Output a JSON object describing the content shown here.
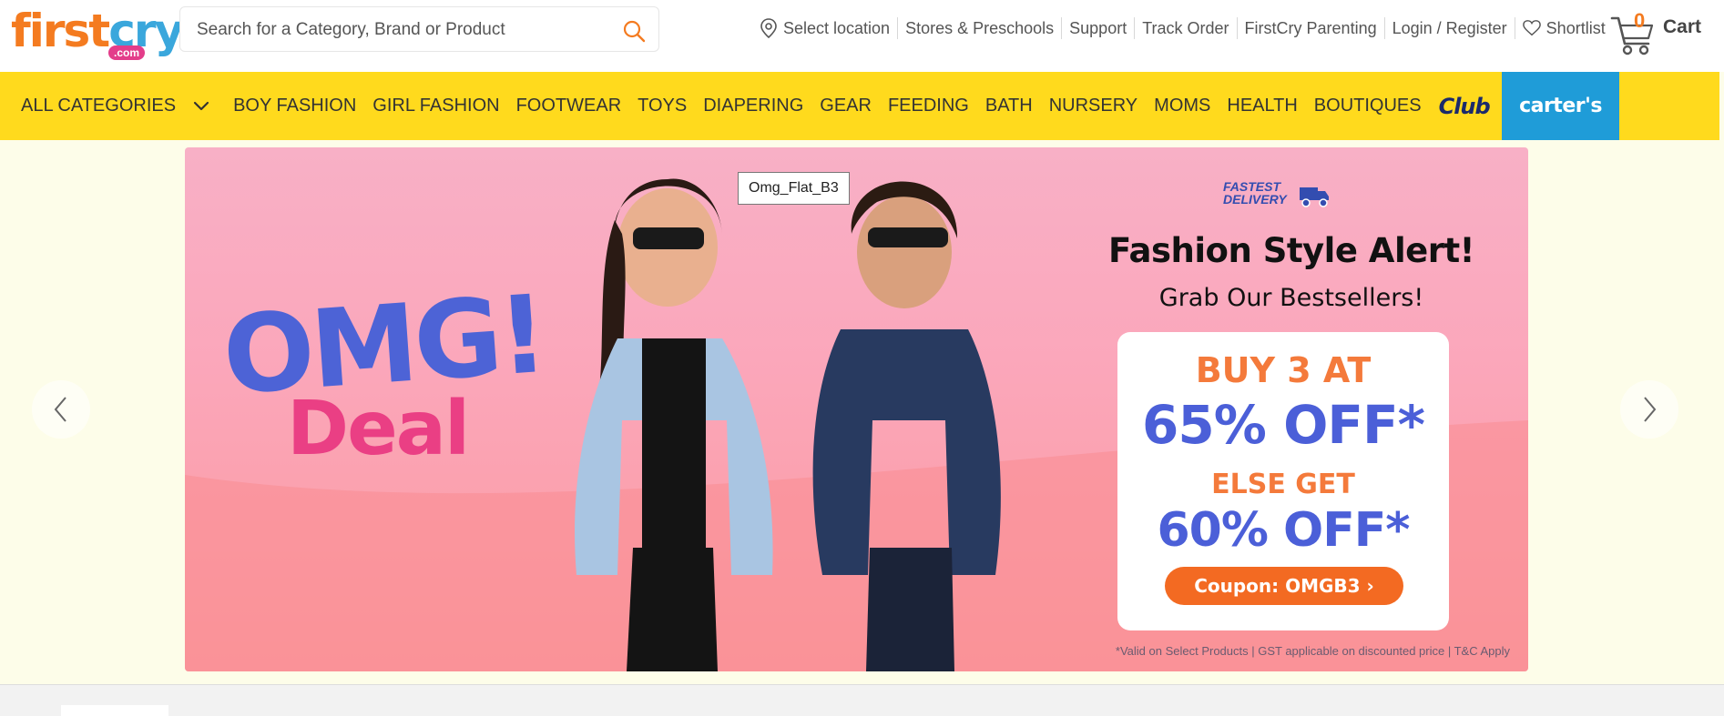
{
  "header": {
    "logo_main_1": "first",
    "logo_main_2": "cry",
    "logo_sub": ".com",
    "search_placeholder": "Search for a Category, Brand or Product",
    "links": {
      "location": "Select location",
      "stores": "Stores & Preschools",
      "support": "Support",
      "track": "Track Order",
      "parenting": "FirstCry Parenting",
      "login": "Login / Register",
      "shortlist": "Shortlist"
    },
    "cart_count": "0",
    "cart_label": "Cart"
  },
  "nav": {
    "all_categories": "ALL CATEGORIES",
    "items": [
      "BOY FASHION",
      "GIRL FASHION",
      "FOOTWEAR",
      "TOYS",
      "DIAPERING",
      "GEAR",
      "FEEDING",
      "BATH",
      "NURSERY",
      "MOMS",
      "HEALTH",
      "BOUTIQUES"
    ],
    "club": "Club",
    "carters": "carter's"
  },
  "banner": {
    "tooltip": "Omg_Flat_B3",
    "omg": "OMG!",
    "deal": "Deal",
    "fastest_1": "FASTEST",
    "fastest_2": "DELIVERY",
    "headline": "Fashion Style Alert!",
    "subline": "Grab Our Bestsellers!",
    "offer_1": "BUY 3 AT",
    "offer_1_value": "65% OFF*",
    "offer_2": "ELSE GET",
    "offer_2_value": "60% OFF*",
    "coupon": "Coupon: OMGB3 ›",
    "terms": "*Valid on Select Products | GST applicable on discounted price | T&C Apply"
  },
  "colors": {
    "brand_yellow": "#ffda1d",
    "brand_orange": "#f47b20",
    "carters_blue": "#1f9cd8",
    "offer_blue": "#4b5fd8",
    "deal_pink": "#ea3f84"
  }
}
